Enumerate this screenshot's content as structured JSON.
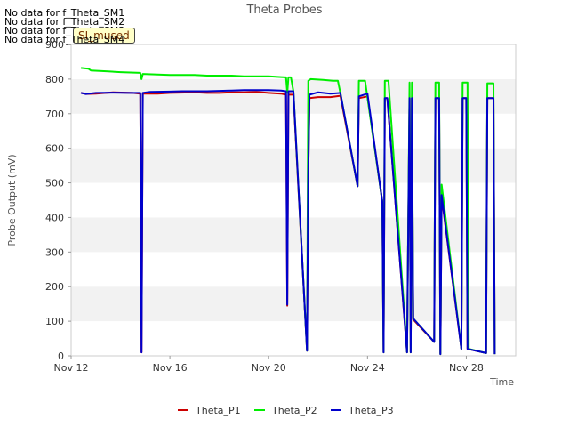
{
  "notices": [
    "No data for f_Theta_SM1",
    "No data for f_Theta_SM2",
    "No data for f_Theta_SM3",
    "No data for f_Theta_SM4"
  ],
  "badge_label": "SI_mused",
  "chart_data": {
    "type": "line",
    "title": "Theta Probes",
    "xlabel": "Time",
    "ylabel": "Probe Output (mV)",
    "x_unit": "days from Nov 12",
    "xlim": [
      12,
      30
    ],
    "ylim": [
      0,
      900
    ],
    "x_ticks": [
      {
        "value": 12,
        "label": "Nov 12"
      },
      {
        "value": 16,
        "label": "Nov 16"
      },
      {
        "value": 20,
        "label": "Nov 20"
      },
      {
        "value": 24,
        "label": "Nov 24"
      },
      {
        "value": 28,
        "label": "Nov 28"
      }
    ],
    "y_ticks": [
      0,
      100,
      200,
      300,
      400,
      500,
      600,
      700,
      800,
      900
    ],
    "grid": "horizontal alternating bands",
    "legend_position": "bottom",
    "series": [
      {
        "name": "Theta_P1",
        "color": "#cc0000",
        "points": [
          [
            12.4,
            760
          ],
          [
            12.6,
            757
          ],
          [
            13,
            758
          ],
          [
            13.7,
            762
          ],
          [
            14.5,
            760
          ],
          [
            14.8,
            758
          ],
          [
            14.85,
            10
          ],
          [
            14.9,
            758
          ],
          [
            15.5,
            758
          ],
          [
            16,
            760
          ],
          [
            17,
            762
          ],
          [
            17.5,
            760
          ],
          [
            18,
            760
          ],
          [
            18.5,
            762
          ],
          [
            19,
            762
          ],
          [
            19.5,
            763
          ],
          [
            20,
            760
          ],
          [
            20.5,
            758
          ],
          [
            20.7,
            755
          ],
          [
            20.75,
            145
          ],
          [
            20.8,
            755
          ],
          [
            21,
            755
          ],
          [
            21.55,
            15
          ],
          [
            21.6,
            520
          ],
          [
            21.65,
            745
          ],
          [
            22,
            748
          ],
          [
            22.5,
            748
          ],
          [
            22.9,
            752
          ],
          [
            23.6,
            490
          ],
          [
            23.65,
            745
          ],
          [
            24,
            750
          ],
          [
            24.6,
            445
          ],
          [
            24.65,
            10
          ],
          [
            24.7,
            745
          ],
          [
            24.8,
            745
          ],
          [
            25.6,
            10
          ],
          [
            25.7,
            745
          ],
          [
            25.75,
            10
          ],
          [
            25.8,
            745
          ],
          [
            25.85,
            105
          ],
          [
            26.7,
            40
          ],
          [
            26.75,
            745
          ],
          [
            26.9,
            745
          ],
          [
            26.95,
            5
          ],
          [
            27.0,
            460
          ],
          [
            27.8,
            20
          ],
          [
            27.85,
            745
          ],
          [
            28.0,
            745
          ],
          [
            28.05,
            20
          ],
          [
            28.8,
            8
          ],
          [
            28.85,
            745
          ],
          [
            29.1,
            745
          ],
          [
            29.15,
            5
          ]
        ]
      },
      {
        "name": "Theta_P2",
        "color": "#00ee00",
        "points": [
          [
            12.4,
            832
          ],
          [
            12.7,
            830
          ],
          [
            12.8,
            825
          ],
          [
            13.5,
            822
          ],
          [
            14,
            820
          ],
          [
            14.8,
            818
          ],
          [
            14.85,
            800
          ],
          [
            14.9,
            815
          ],
          [
            16,
            812
          ],
          [
            17,
            812
          ],
          [
            17.5,
            810
          ],
          [
            18,
            810
          ],
          [
            18.5,
            810
          ],
          [
            19,
            808
          ],
          [
            20,
            808
          ],
          [
            20.5,
            806
          ],
          [
            20.7,
            805
          ],
          [
            20.75,
            760
          ],
          [
            20.8,
            805
          ],
          [
            20.9,
            805
          ],
          [
            21,
            765
          ],
          [
            21.55,
            15
          ],
          [
            21.6,
            795
          ],
          [
            21.7,
            800
          ],
          [
            22.2,
            798
          ],
          [
            22.6,
            795
          ],
          [
            22.8,
            795
          ],
          [
            22.9,
            760
          ],
          [
            23.6,
            490
          ],
          [
            23.65,
            795
          ],
          [
            23.9,
            795
          ],
          [
            24.6,
            445
          ],
          [
            24.65,
            10
          ],
          [
            24.7,
            795
          ],
          [
            24.85,
            795
          ],
          [
            25.6,
            10
          ],
          [
            25.7,
            790
          ],
          [
            25.75,
            10
          ],
          [
            25.8,
            790
          ],
          [
            25.85,
            108
          ],
          [
            26.7,
            40
          ],
          [
            26.75,
            790
          ],
          [
            26.9,
            790
          ],
          [
            26.95,
            5
          ],
          [
            27.0,
            495
          ],
          [
            27.8,
            20
          ],
          [
            27.85,
            790
          ],
          [
            28.05,
            790
          ],
          [
            28.1,
            20
          ],
          [
            28.8,
            8
          ],
          [
            28.85,
            788
          ],
          [
            29.1,
            788
          ],
          [
            29.15,
            5
          ]
        ]
      },
      {
        "name": "Theta_P3",
        "color": "#0000cc",
        "points": [
          [
            12.4,
            760
          ],
          [
            12.6,
            757
          ],
          [
            13,
            760
          ],
          [
            13.7,
            761
          ],
          [
            14.3,
            760
          ],
          [
            14.8,
            760
          ],
          [
            14.85,
            10
          ],
          [
            14.9,
            760
          ],
          [
            15.2,
            763
          ],
          [
            16,
            764
          ],
          [
            16.5,
            765
          ],
          [
            17,
            765
          ],
          [
            17.5,
            765
          ],
          [
            18,
            766
          ],
          [
            18.5,
            767
          ],
          [
            19,
            768
          ],
          [
            19.5,
            768
          ],
          [
            20,
            768
          ],
          [
            20.5,
            767
          ],
          [
            20.7,
            765
          ],
          [
            20.75,
            148
          ],
          [
            20.8,
            765
          ],
          [
            21,
            765
          ],
          [
            21.55,
            15
          ],
          [
            21.6,
            520
          ],
          [
            21.65,
            755
          ],
          [
            22,
            762
          ],
          [
            22.5,
            758
          ],
          [
            22.9,
            760
          ],
          [
            23.6,
            490
          ],
          [
            23.65,
            750
          ],
          [
            24,
            758
          ],
          [
            24.6,
            445
          ],
          [
            24.65,
            10
          ],
          [
            24.7,
            745
          ],
          [
            24.8,
            745
          ],
          [
            25.6,
            10
          ],
          [
            25.7,
            745
          ],
          [
            25.75,
            10
          ],
          [
            25.8,
            745
          ],
          [
            25.85,
            108
          ],
          [
            26.7,
            40
          ],
          [
            26.75,
            745
          ],
          [
            26.9,
            745
          ],
          [
            26.95,
            5
          ],
          [
            27.0,
            465
          ],
          [
            27.8,
            20
          ],
          [
            27.85,
            745
          ],
          [
            28.0,
            745
          ],
          [
            28.05,
            20
          ],
          [
            28.8,
            8
          ],
          [
            28.85,
            745
          ],
          [
            29.1,
            745
          ],
          [
            29.15,
            5
          ]
        ]
      }
    ]
  }
}
